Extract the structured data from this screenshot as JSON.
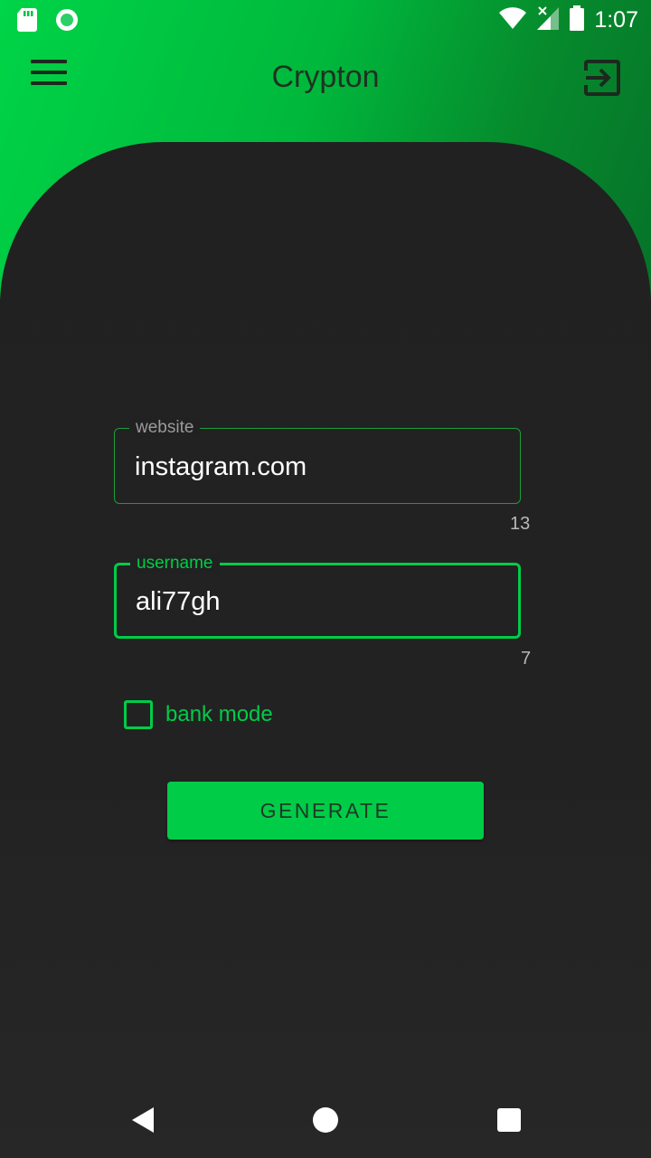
{
  "status_bar": {
    "time": "1:07",
    "icons": [
      "sd-card-icon",
      "notification-dot-icon",
      "wifi-icon",
      "signal-icon",
      "battery-icon"
    ]
  },
  "toolbar": {
    "title": "Crypton",
    "menu_icon": "hamburger-menu-icon",
    "exit_icon": "exit-icon"
  },
  "form": {
    "website": {
      "label": "website",
      "value": "instagram.com",
      "counter": "13"
    },
    "username": {
      "label": "username",
      "value": "ali77gh",
      "counter": "7"
    },
    "bank_mode": {
      "label": "bank mode",
      "checked": false
    },
    "generate_label": "GENERATE"
  },
  "colors": {
    "accent": "#00cc48",
    "header_gradient_start": "#00d447",
    "header_gradient_end": "#06732a",
    "background": "#222222"
  },
  "navigation_bar": {
    "icons": [
      "back-icon",
      "home-icon",
      "recents-icon"
    ]
  }
}
